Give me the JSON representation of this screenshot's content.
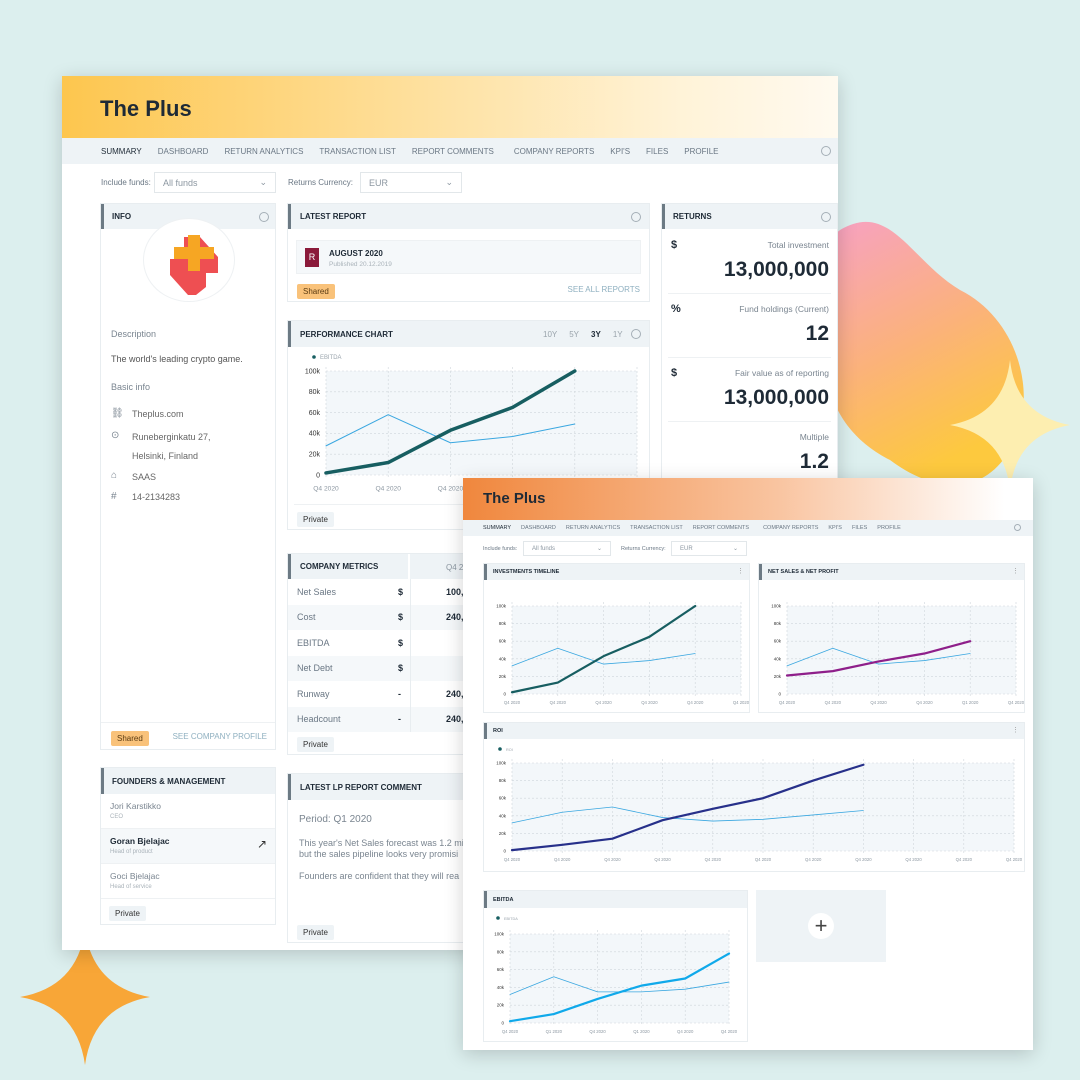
{
  "colors": {
    "background": "#dcefee",
    "header_back": "#fdc64e",
    "header_front": "#f0873d",
    "teal_series": "#175e61",
    "thin_series": "#3aa7e0",
    "purple_series": "#8e1f8a",
    "navy_series": "#27308a",
    "cyan_series": "#10a9ea",
    "shared_badge": "#f9c27a"
  },
  "back": {
    "title": "The Plus",
    "nav": [
      "SUMMARY",
      "DASHBOARD",
      "RETURN ANALYTICS",
      "TRANSACTION LIST",
      "REPORT COMMENTS",
      "COMPANY REPORTS",
      "KPI'S",
      "FILES",
      "PROFILE"
    ],
    "filters": {
      "funds_label": "Include funds:",
      "funds_value": "All funds",
      "currency_label": "Returns Currency:",
      "currency_value": "EUR"
    },
    "info": {
      "title": "INFO",
      "description_label": "Description",
      "description": "The world's leading crypto game.",
      "basic_label": "Basic info",
      "website": "Theplus.com",
      "address1": "Runeberginkatu 27,",
      "address2": "Helsinki, Finland",
      "industry": "SAAS",
      "business_id": "14-2134283",
      "badge": "Shared",
      "link": "SEE COMPANY PROFILE"
    },
    "latest_report": {
      "title": "LATEST REPORT",
      "icon_letter": "R",
      "name": "AUGUST 2020",
      "published": "Published 20.12.2019",
      "badge": "Shared",
      "link": "SEE ALL REPORTS"
    },
    "performance": {
      "title": "PERFORMANCE CHART",
      "ranges": [
        "10Y",
        "5Y",
        "3Y",
        "1Y"
      ],
      "active_range": "3Y",
      "badge": "Private"
    },
    "returns": {
      "title": "RETURNS",
      "items": [
        {
          "sym": "$",
          "label": "Total investment",
          "value": "13,000,000"
        },
        {
          "sym": "%",
          "label": "Fund holdings (Current)",
          "value": "12"
        },
        {
          "sym": "$",
          "label": "Fair value as of reporting",
          "value": "13,000,000"
        },
        {
          "sym": "",
          "label": "Multiple",
          "value": "1.2"
        }
      ]
    },
    "metrics": {
      "title": "COMPANY METRICS",
      "column": "Q4 2",
      "rows": [
        {
          "name": "Net Sales",
          "unit": "$",
          "value": "100,0"
        },
        {
          "name": "Cost",
          "unit": "$",
          "value": "240,0"
        },
        {
          "name": "EBITDA",
          "unit": "$",
          "value": ""
        },
        {
          "name": "Net Debt",
          "unit": "$",
          "value": ""
        },
        {
          "name": "Runway",
          "unit": "-",
          "value": "240,0"
        },
        {
          "name": "Headcount",
          "unit": "-",
          "value": "240,0"
        }
      ],
      "badge": "Private"
    },
    "comment": {
      "title": "LATEST LP REPORT COMMENT",
      "period": "Period:  Q1 2020",
      "p1": "This year's Net Sales forecast was 1.2 mi",
      "p2": "but the sales pipeline looks very promisi",
      "p3": "Founders are confident that they will rea",
      "badge": "Private"
    },
    "founders": {
      "title": "FOUNDERS & MANAGEMENT",
      "people": [
        {
          "name": "Jori Karstikko",
          "role": "CEO"
        },
        {
          "name": "Goran Bjelajac",
          "role": "Head of product"
        },
        {
          "name": "Goci Bjelajac",
          "role": "Head of service"
        }
      ],
      "badge": "Private"
    }
  },
  "front": {
    "title": "The Plus",
    "nav": [
      "SUMMARY",
      "DASHBOARD",
      "RETURN ANALYTICS",
      "TRANSACTION LIST",
      "REPORT COMMENTS",
      "COMPANY REPORTS",
      "KPI'S",
      "FILES",
      "PROFILE"
    ],
    "filters": {
      "funds_label": "Include funds:",
      "funds_value": "All funds",
      "currency_label": "Returns Currency:",
      "currency_value": "EUR"
    },
    "cards": {
      "investments": "INVESTMENTS TIMELINE",
      "netsales": "NET SALES & NET PROFIT",
      "roi": "ROI",
      "ebitda": "EBITDA"
    }
  },
  "chart_data": [
    {
      "key": "perf",
      "type": "line",
      "legend": "EBITDA",
      "yticks": [
        "0",
        "20k",
        "40k",
        "60k",
        "80k",
        "100k"
      ],
      "ylim": [
        0,
        100000
      ],
      "grid": true,
      "categories": [
        "Q4 2020",
        "Q4 2020",
        "Q4 2020",
        "Q4 2020",
        "Q4 2020",
        "Q4 2020"
      ],
      "series": [
        {
          "name": "EBITDA",
          "color": "#175e61",
          "values": [
            2000,
            12000,
            43000,
            65000,
            100000
          ]
        },
        {
          "color": "#3aa7e0",
          "values": [
            28000,
            58000,
            31000,
            37000,
            49000
          ]
        }
      ]
    },
    {
      "key": "inv",
      "type": "line",
      "legend": "",
      "yticks": [
        "0",
        "20k",
        "40k",
        "60k",
        "80k",
        "100k"
      ],
      "ylim": [
        0,
        100000
      ],
      "grid": true,
      "categories": [
        "Q4 2020",
        "Q4 2020",
        "Q4 2020",
        "Q4 2020",
        "Q4 2020",
        "Q4 2020"
      ],
      "series": [
        {
          "color": "#175e61",
          "values": [
            2000,
            13000,
            43000,
            65000,
            100000
          ]
        },
        {
          "color": "#3aa7e0",
          "values": [
            32000,
            52000,
            34000,
            38000,
            46000
          ]
        }
      ]
    },
    {
      "key": "ns",
      "type": "line",
      "legend": "",
      "yticks": [
        "0",
        "20k",
        "40k",
        "60k",
        "80k",
        "100k"
      ],
      "ylim": [
        0,
        100000
      ],
      "grid": true,
      "categories": [
        "Q4 2020",
        "Q4 2020",
        "Q4 2020",
        "Q4 2020",
        "Q1 2020",
        "Q4 2020"
      ],
      "series": [
        {
          "color": "#8e1f8a",
          "values": [
            21000,
            26000,
            37000,
            46000,
            60000
          ]
        },
        {
          "color": "#3aa7e0",
          "values": [
            32000,
            52000,
            34000,
            38000,
            46000
          ]
        }
      ]
    },
    {
      "key": "roi",
      "type": "line",
      "legend": "ROI",
      "yticks": [
        "0",
        "20k",
        "40k",
        "60k",
        "80k",
        "100k"
      ],
      "ylim": [
        0,
        100000
      ],
      "grid": true,
      "categories": [
        "Q4 2020",
        "Q4 2020",
        "Q4 2020",
        "Q4 2020",
        "Q4 2020",
        "Q4 2020",
        "Q4 2020",
        "Q4 2020",
        "Q4 2020",
        "Q4 2020",
        "Q4 2020"
      ],
      "series": [
        {
          "name": "ROI",
          "color": "#27308a",
          "values": [
            1000,
            7000,
            14000,
            35000,
            48000,
            60000,
            80000,
            98000
          ]
        },
        {
          "color": "#3aa7e0",
          "values": [
            32000,
            44000,
            50000,
            38000,
            34000,
            36000,
            41000,
            46000
          ]
        }
      ]
    },
    {
      "key": "ebitda",
      "type": "line",
      "legend": "EBITDA",
      "yticks": [
        "0",
        "20k",
        "40k",
        "60k",
        "80k",
        "100k"
      ],
      "ylim": [
        0,
        100000
      ],
      "grid": true,
      "categories": [
        "Q4 2020",
        "Q1 2020",
        "Q4 2020",
        "Q1 2020",
        "Q4 2020",
        "Q4 2020"
      ],
      "series": [
        {
          "name": "EBITDA",
          "color": "#10a9ea",
          "values": [
            2000,
            10000,
            27000,
            42000,
            50000,
            78000
          ]
        },
        {
          "color": "#3aa7e0",
          "values": [
            32000,
            52000,
            35000,
            35000,
            38000,
            46000
          ]
        }
      ]
    }
  ]
}
